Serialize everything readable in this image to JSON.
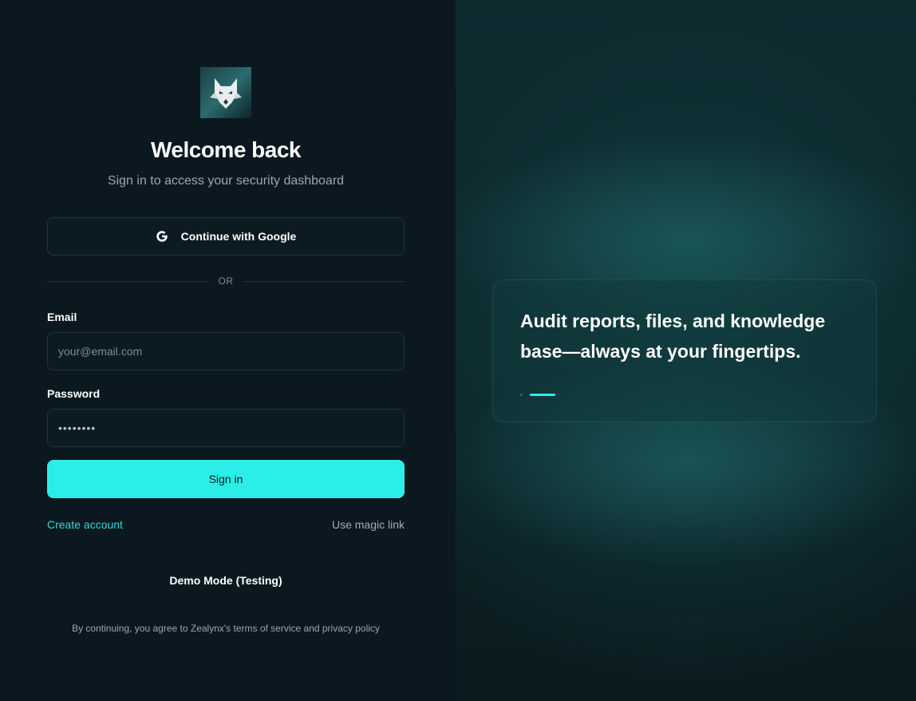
{
  "login": {
    "title": "Welcome back",
    "subtitle": "Sign in to access your security dashboard",
    "google_button_label": "Continue with Google",
    "divider_text": "OR",
    "email_label": "Email",
    "email_placeholder": "your@email.com",
    "password_label": "Password",
    "password_value": "••••••••",
    "signin_label": "Sign in",
    "create_account_label": "Create account",
    "magic_link_label": "Use magic link",
    "demo_mode_label": "Demo Mode (Testing)",
    "terms_text": "By continuing, you agree to Zealynx's terms of service and privacy policy"
  },
  "promo": {
    "headline": "Audit reports, files, and knowledge base—always at your fingertips.",
    "carousel_active_index": 1,
    "carousel_count": 2
  },
  "icons": {
    "logo": "lynx-logo-icon",
    "google": "google-g-icon"
  },
  "colors": {
    "background": "#0b1820",
    "accent": "#2ceee8",
    "link": "#2fd8d8"
  }
}
